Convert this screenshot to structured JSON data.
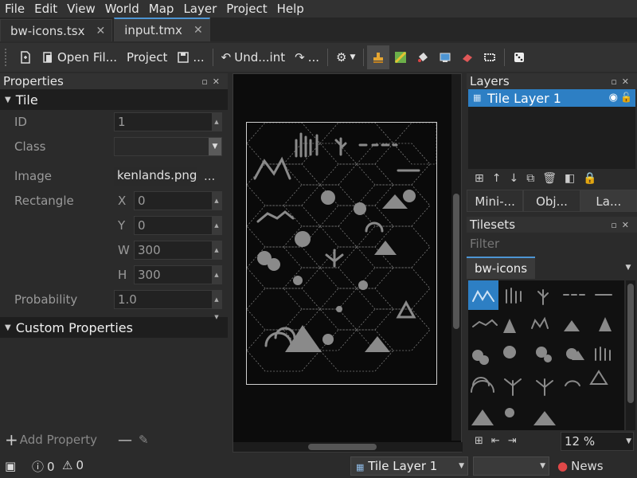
{
  "menu": [
    "File",
    "Edit",
    "View",
    "World",
    "Map",
    "Layer",
    "Project",
    "Help"
  ],
  "doc_tabs": [
    {
      "label": "bw-icons.tsx",
      "active": false
    },
    {
      "label": "input.tmx",
      "active": true
    }
  ],
  "toolbar": {
    "open_file": "Open Fil...",
    "project": "Project",
    "save_more": "...",
    "undo": "Und...int",
    "redo_more": "..."
  },
  "properties": {
    "title": "Properties",
    "tile_section": "Tile",
    "rows": {
      "id_label": "ID",
      "id_value": "1",
      "class_label": "Class",
      "class_value": "",
      "image_label": "Image",
      "image_value": "kenlands.png",
      "image_more": "...",
      "rect_label": "Rectangle",
      "x_label": "X",
      "x_value": "0",
      "y_label": "Y",
      "y_value": "0",
      "w_label": "W",
      "w_value": "300",
      "h_label": "H",
      "h_value": "300",
      "prob_label": "Probability",
      "prob_value": "1.0"
    },
    "custom_section": "Custom Properties",
    "add_property": "Add Property"
  },
  "layers": {
    "title": "Layers",
    "items": [
      {
        "name": "Tile Layer 1",
        "selected": true
      }
    ],
    "tabs": [
      "Mini-...",
      "Obj...",
      "La..."
    ]
  },
  "tilesets": {
    "title": "Tilesets",
    "filter_placeholder": "Filter",
    "tab": "bw-icons",
    "zoom": "12 %"
  },
  "statusbar": {
    "errors": "0",
    "warnings": "0",
    "current_layer": "Tile Layer 1",
    "news": "News"
  },
  "colors": {
    "accent": "#2d7fc4",
    "tab_highlight": "#4d95d3",
    "background": "#2b2b2b",
    "map_bg": "#0a0a0a",
    "icon_gray": "#8a8a8a"
  }
}
